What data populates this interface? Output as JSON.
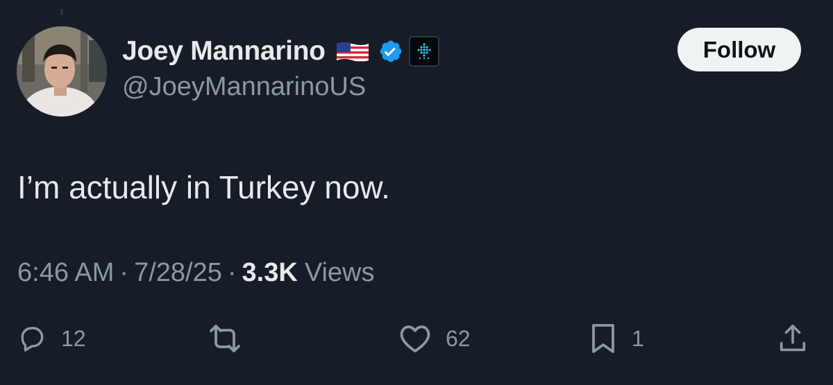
{
  "author": {
    "display_name": "Joey Mannarino",
    "handle": "@JoeyMannarinoUS",
    "flag_emoji_name": "us-flag-icon",
    "verified": true,
    "affiliate_badge_name": "affiliate-badge-icon"
  },
  "follow_button": {
    "label": "Follow"
  },
  "tweet": {
    "text": "I’m actually in Turkey now.",
    "time": "6:46 AM",
    "date": "7/28/25",
    "separator": "·",
    "views_count": "3.3K",
    "views_label": "Views"
  },
  "actions": {
    "replies": {
      "icon": "reply-icon",
      "count": "12"
    },
    "reposts": {
      "icon": "repost-icon",
      "count": ""
    },
    "likes": {
      "icon": "heart-icon",
      "count": "62"
    },
    "bookmarks": {
      "icon": "bookmark-icon",
      "count": "1"
    },
    "share": {
      "icon": "share-icon"
    }
  },
  "colors": {
    "background": "#161d27",
    "primary_text": "#e7e9ea",
    "secondary_text": "#8b98a5",
    "verified_blue": "#1d9bf0",
    "follow_bg": "#eff3f4"
  }
}
